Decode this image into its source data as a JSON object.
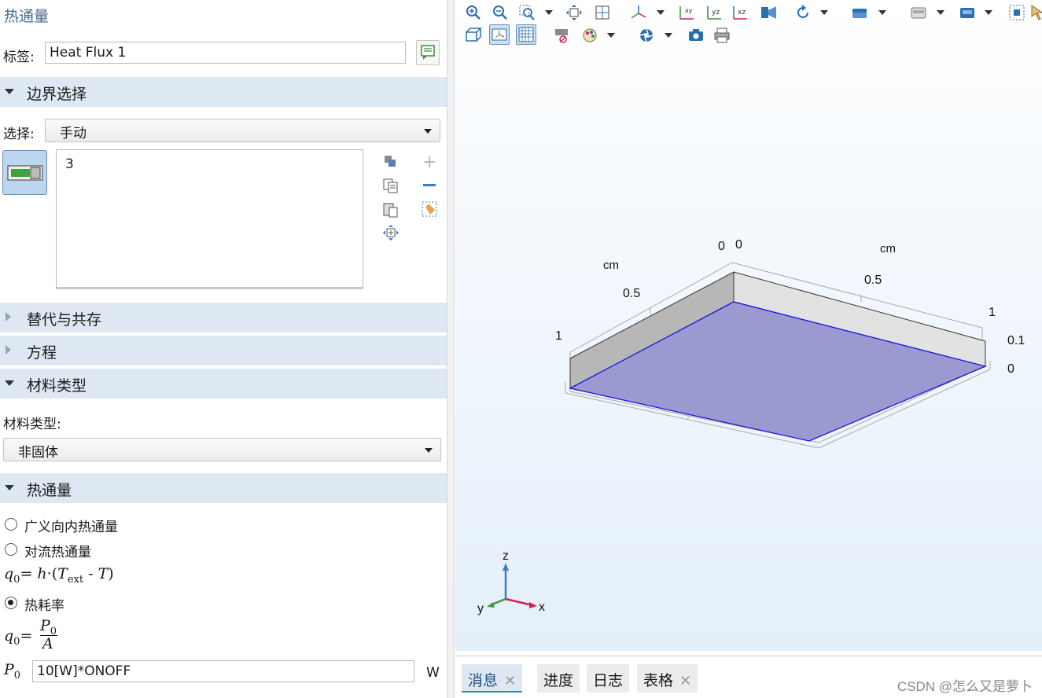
{
  "panel": {
    "title": "热通量",
    "label_caption": "标签:",
    "label_value": "Heat Flux 1"
  },
  "boundary": {
    "section_title": "边界选择",
    "select_caption": "选择:",
    "select_value": "手动",
    "selected_items": [
      "3"
    ]
  },
  "sections": {
    "override": "替代与共存",
    "equation": "方程",
    "material_type": "材料类型",
    "heat_flux": "热通量"
  },
  "material": {
    "caption": "材料类型:",
    "value": "非固体"
  },
  "heat_flux": {
    "options": [
      {
        "label": "广义向内热通量",
        "selected": false
      },
      {
        "label": "对流热通量",
        "selected": false
      },
      {
        "label": "热耗率",
        "selected": true
      }
    ],
    "formula_convective": {
      "lhs": "q",
      "lhs_sub": "0",
      "eq": "=",
      "h": "h",
      "dot": "·",
      "open": "(",
      "t": "T",
      "t_sub": "ext",
      "minus": " - ",
      "t2": "T",
      "close": ")"
    },
    "formula_rate": {
      "lhs": "q",
      "lhs_sub": "0",
      "eq": "=",
      "num": "P",
      "num_sub": "0",
      "den": "A"
    },
    "p0_symbol": "P",
    "p0_sub": "0",
    "p0_value": "10[W]*ONOFF",
    "p0_unit": "W"
  },
  "graphics": {
    "x_axis_labels": [
      "0",
      "0.5",
      "1"
    ],
    "y_axis_labels": [
      "0",
      "0.5",
      "1"
    ],
    "z_axis_labels": [
      "0.1",
      "0"
    ],
    "unit_x": "cm",
    "unit_y": "cm",
    "triad": {
      "z": "z",
      "y": "y",
      "x": "x"
    },
    "face_color": "#9b9ad0",
    "edge_color": "#0000e0"
  },
  "bottom_tabs": [
    {
      "label": "消息",
      "closable": true,
      "active": true
    },
    {
      "label": "进度",
      "closable": false,
      "active": false
    },
    {
      "label": "日志",
      "closable": false,
      "active": false
    },
    {
      "label": "表格",
      "closable": true,
      "active": false
    }
  ],
  "watermark": "CSDN @怎么又是萝卜"
}
